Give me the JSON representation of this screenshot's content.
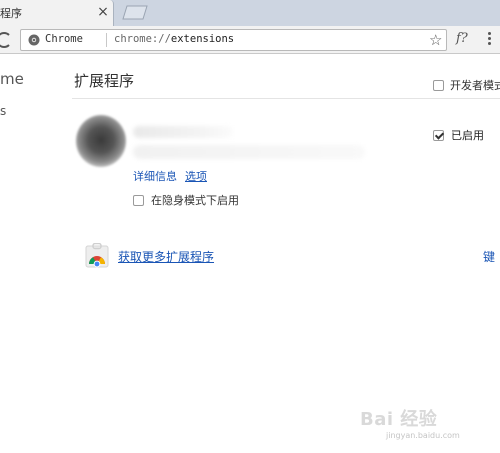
{
  "tab": {
    "title": "程序",
    "close_label": "×"
  },
  "toolbar": {
    "chip_label": "Chrome",
    "url_scheme": "chrome://",
    "url_path": "extensions",
    "star_label": "☆",
    "fx_label": "f?"
  },
  "sidebar": {
    "title": "me",
    "item": "s"
  },
  "main": {
    "title": "扩展程序",
    "developer_mode_label": "开发者模式",
    "developer_mode_checked": false,
    "extension": {
      "enabled_label": "已启用",
      "enabled": true,
      "details_link": "详细信息",
      "options_link": "选项",
      "incognito_label": "在隐身模式下启用",
      "incognito_checked": false
    },
    "get_more_link": "获取更多扩展程序",
    "keyboard_link": "键"
  },
  "watermark": {
    "text": "Bai 经验",
    "url": "jingyan.baidu.com"
  },
  "colors": {
    "link": "#1a55b5",
    "tabstrip": "#cdd5e1",
    "toolbar": "#f2f2f2"
  }
}
